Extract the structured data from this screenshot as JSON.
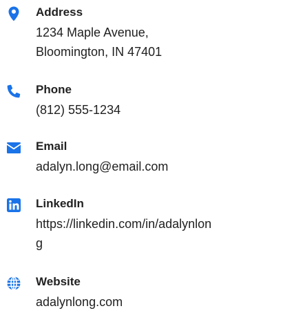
{
  "accent_color": "#1a73e8",
  "contact": {
    "address": {
      "icon": "location-pin-icon",
      "label": "Address",
      "lines": [
        "1234 Maple Avenue,",
        "Bloomington, IN 47401"
      ]
    },
    "phone": {
      "icon": "phone-icon",
      "label": "Phone",
      "value": "(812) 555-1234"
    },
    "email": {
      "icon": "envelope-icon",
      "label": "Email",
      "value": "adalyn.long@email.com"
    },
    "linkedin": {
      "icon": "linkedin-icon",
      "label": "LinkedIn",
      "lines": [
        "https://linkedin.com/in/adalynlon",
        "g"
      ]
    },
    "website": {
      "icon": "globe-icon",
      "label": "Website",
      "value": "adalynlong.com"
    }
  }
}
